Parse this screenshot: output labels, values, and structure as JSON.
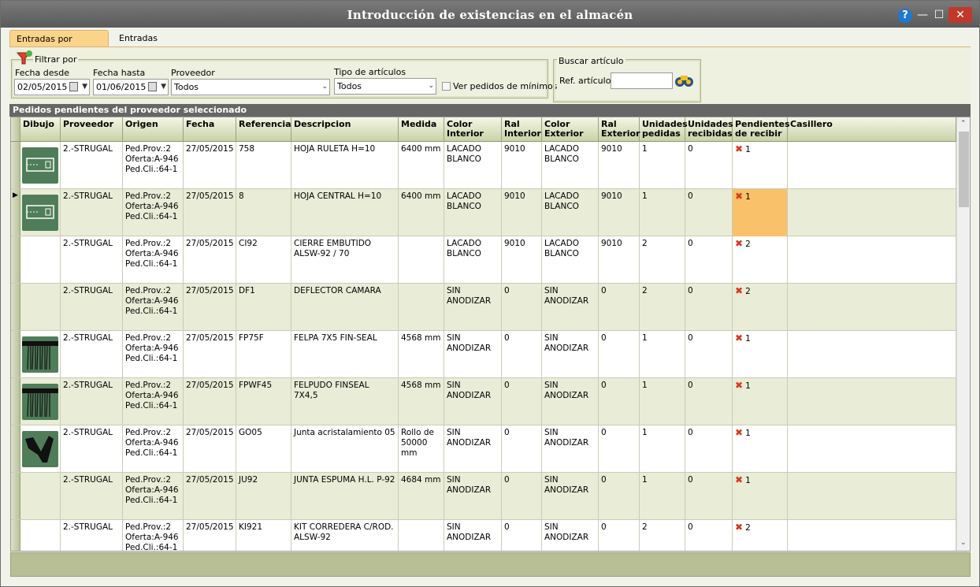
{
  "window": {
    "title": "Introducción de existencias en el almacén",
    "help": "?",
    "min": "—",
    "max": "☐",
    "close": "✕"
  },
  "tabs": [
    {
      "label": "Entradas por pedidos",
      "active": true
    },
    {
      "label": "Entradas manuales",
      "active": false
    }
  ],
  "filter": {
    "group_label": "Filtrar por",
    "fecha_desde_label": "Fecha desde",
    "fecha_desde": "02/05/2015",
    "fecha_hasta_label": "Fecha hasta",
    "fecha_hasta": "01/06/2015",
    "proveedor_label": "Proveedor",
    "proveedor": "Todos",
    "tipo_label": "Tipo de artículos",
    "tipo": "Todos",
    "minimos_label": "Ver pedidos de mínimos"
  },
  "search": {
    "group_label": "Buscar artículo",
    "ref_label": "Ref. artículo",
    "ref_value": ""
  },
  "section_title": "Pedidos pendientes del proveedor seleccionado",
  "columns": [
    "Dibujo",
    "Proveedor",
    "Origen",
    "Fecha",
    "Referencia",
    "Descripcion",
    "Medida",
    "Color Interior",
    "Ral Interior",
    "Color Exterior",
    "Ral Exterior",
    "Unidades pedidas",
    "Unidades recibidas",
    "Pendientes de recibir",
    "Casillero"
  ],
  "rows": [
    {
      "img": "hoja-ruleta",
      "proveedor": "2.-STRUGAL",
      "origen": [
        "Ped.Prov.:2",
        "Oferta:A-946",
        "Ped.Cli.:64-1"
      ],
      "fecha": "27/05/2015",
      "ref": "758",
      "desc": "HOJA RULETA H=10",
      "medida": "6400 mm",
      "ci": "LACADO BLANCO",
      "ri": "9010",
      "ce": "LACADO BLANCO",
      "re": "9010",
      "up": "1",
      "ur": "0",
      "pr": "1",
      "cas": ""
    },
    {
      "img": "hoja-central",
      "proveedor": "2.-STRUGAL",
      "origen": [
        "Ped.Prov.:2",
        "Oferta:A-946",
        "Ped.Cli.:64-1"
      ],
      "fecha": "27/05/2015",
      "ref": "8",
      "desc": "HOJA CENTRAL H=10",
      "medida": "6400 mm",
      "ci": "LACADO BLANCO",
      "ri": "9010",
      "ce": "LACADO BLANCO",
      "re": "9010",
      "up": "1",
      "ur": "0",
      "pr": "1",
      "cas": "",
      "selected": true
    },
    {
      "img": "",
      "proveedor": "2.-STRUGAL",
      "origen": [
        "Ped.Prov.:2",
        "Oferta:A-946",
        "Ped.Cli.:64-1"
      ],
      "fecha": "27/05/2015",
      "ref": "CI92",
      "desc": "CIERRE EMBUTIDO ALSW-92 / 70",
      "medida": "",
      "ci": "LACADO BLANCO",
      "ri": "9010",
      "ce": "LACADO BLANCO",
      "re": "9010",
      "up": "2",
      "ur": "0",
      "pr": "2",
      "cas": ""
    },
    {
      "img": "",
      "proveedor": "2.-STRUGAL",
      "origen": [
        "Ped.Prov.:2",
        "Oferta:A-946",
        "Ped.Cli.:64-1"
      ],
      "fecha": "27/05/2015",
      "ref": "DF1",
      "desc": "DEFLECTOR CAMARA",
      "medida": "",
      "ci": "SIN ANODIZAR",
      "ri": "0",
      "ce": "SIN ANODIZAR",
      "re": "0",
      "up": "2",
      "ur": "0",
      "pr": "2",
      "cas": ""
    },
    {
      "img": "felpa",
      "proveedor": "2.-STRUGAL",
      "origen": [
        "Ped.Prov.:2",
        "Oferta:A-946",
        "Ped.Cli.:64-1"
      ],
      "fecha": "27/05/2015",
      "ref": "FP75F",
      "desc": "FELPA 7X5 FIN-SEAL",
      "medida": "4568 mm",
      "ci": "SIN ANODIZAR",
      "ri": "0",
      "ce": "SIN ANODIZAR",
      "re": "0",
      "up": "1",
      "ur": "0",
      "pr": "1",
      "cas": ""
    },
    {
      "img": "felpa",
      "proveedor": "2.-STRUGAL",
      "origen": [
        "Ped.Prov.:2",
        "Oferta:A-946",
        "Ped.Cli.:64-1"
      ],
      "fecha": "27/05/2015",
      "ref": "FPWF45",
      "desc": "FELPUDO FINSEAL 7X4,5",
      "medida": "4568 mm",
      "ci": "SIN ANODIZAR",
      "ri": "0",
      "ce": "SIN ANODIZAR",
      "re": "0",
      "up": "1",
      "ur": "0",
      "pr": "1",
      "cas": ""
    },
    {
      "img": "junta",
      "proveedor": "2.-STRUGAL",
      "origen": [
        "Ped.Prov.:2",
        "Oferta:A-946",
        "Ped.Cli.:64-1"
      ],
      "fecha": "27/05/2015",
      "ref": "GO05",
      "desc": "Junta acristalamiento 05",
      "medida": "Rollo de 50000 mm",
      "ci": "SIN ANODIZAR",
      "ri": "0",
      "ce": "SIN ANODIZAR",
      "re": "0",
      "up": "1",
      "ur": "0",
      "pr": "1",
      "cas": ""
    },
    {
      "img": "",
      "proveedor": "2.-STRUGAL",
      "origen": [
        "Ped.Prov.:2",
        "Oferta:A-946",
        "Ped.Cli.:64-1"
      ],
      "fecha": "27/05/2015",
      "ref": "JU92",
      "desc": "JUNTA ESPUMA H.L. P-92",
      "medida": "4684 mm",
      "ci": "SIN ANODIZAR",
      "ri": "0",
      "ce": "SIN ANODIZAR",
      "re": "0",
      "up": "1",
      "ur": "0",
      "pr": "1",
      "cas": ""
    },
    {
      "img": "",
      "proveedor": "2.-STRUGAL",
      "origen": [
        "Ped.Prov.:2",
        "Oferta:A-946",
        "Ped.Cli.:64-1"
      ],
      "fecha": "27/05/2015",
      "ref": "KI921",
      "desc": "KIT CORREDERA C/ROD. ALSW-92",
      "medida": "",
      "ci": "SIN ANODIZAR",
      "ri": "0",
      "ce": "SIN ANODIZAR",
      "re": "0",
      "up": "2",
      "ur": "0",
      "pr": "2",
      "cas": ""
    }
  ]
}
